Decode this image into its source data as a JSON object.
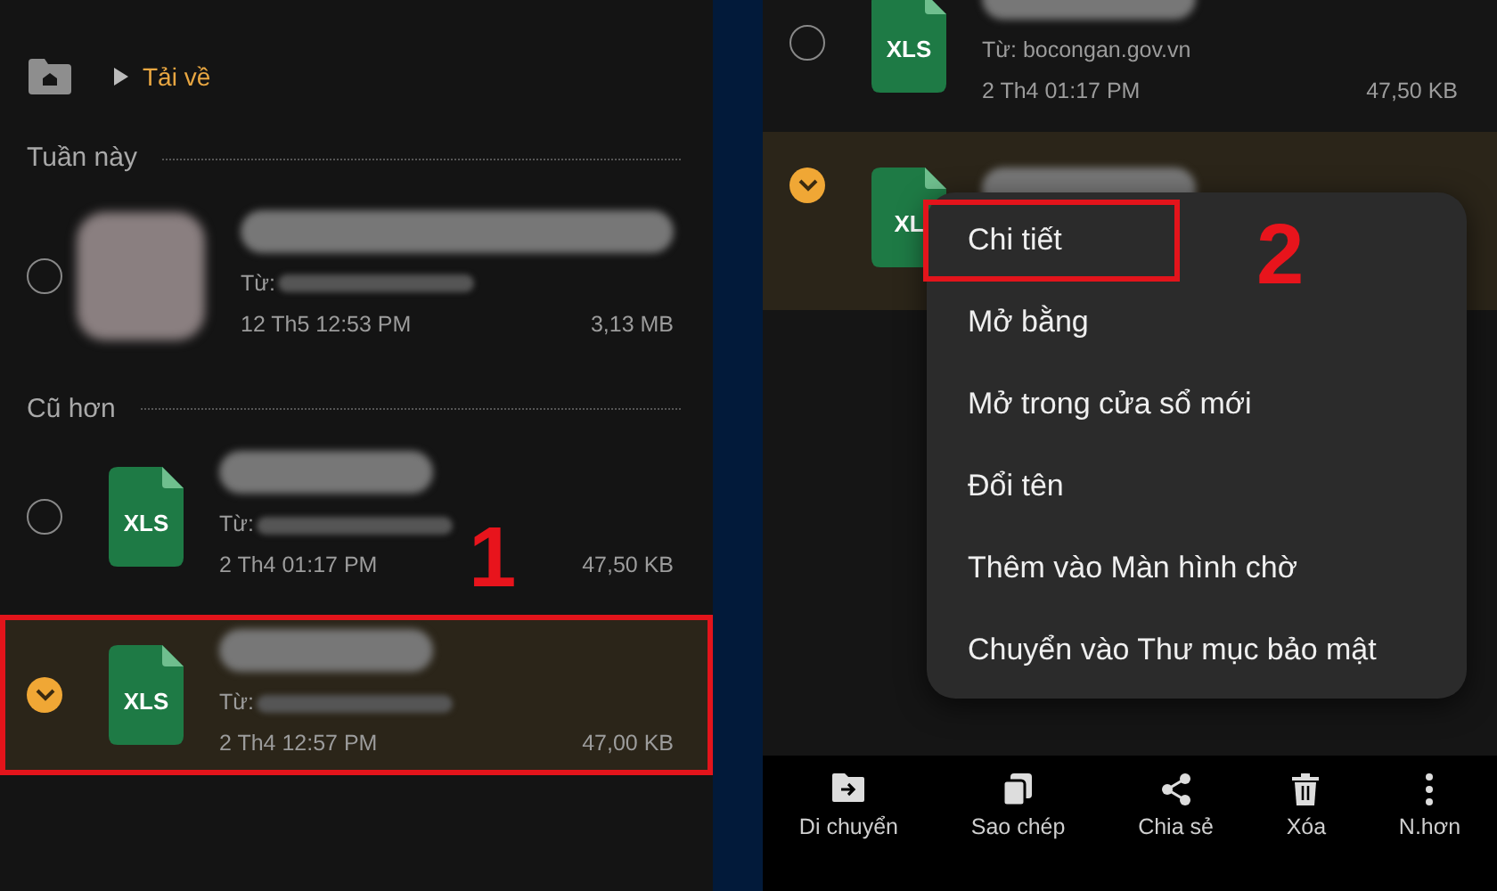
{
  "left_screen": {
    "breadcrumb": {
      "folder": "Tải về"
    },
    "sections": [
      {
        "title": "Tuần này",
        "files": [
          {
            "kind": "image",
            "from": "Từ:",
            "date": "12 Th5 12:53 PM",
            "size": "3,13 MB",
            "selected": false,
            "annotated": false
          }
        ]
      },
      {
        "title": "Cũ hơn",
        "files": [
          {
            "kind": "xls",
            "icon_label": "XLS",
            "from": "Từ:",
            "date": "2 Th4 01:17 PM",
            "size": "47,50 KB",
            "selected": false,
            "annotated": false
          },
          {
            "kind": "xls",
            "icon_label": "XLS",
            "from": "Từ:",
            "date": "2 Th4 12:57 PM",
            "size": "47,00 KB",
            "selected": true,
            "annotated": true
          }
        ]
      }
    ],
    "annotation": "1"
  },
  "right_screen": {
    "files": [
      {
        "kind": "xls",
        "icon_label": "XLS",
        "from": "Từ: bocongan.gov.vn",
        "date": "2 Th4 01:17 PM",
        "size": "47,50 KB",
        "selected": false
      },
      {
        "kind": "xls",
        "icon_label": "XL",
        "selected": true
      }
    ],
    "menu": [
      {
        "label": "Chi tiết",
        "annotated": true
      },
      {
        "label": "Mở bằng",
        "annotated": false
      },
      {
        "label": "Mở trong cửa sổ mới",
        "annotated": false
      },
      {
        "label": "Đổi tên",
        "annotated": false
      },
      {
        "label": "Thêm vào Màn hình chờ",
        "annotated": false
      },
      {
        "label": "Chuyển vào Thư mục bảo mật",
        "annotated": false
      }
    ],
    "annotation": "2",
    "toolbar": [
      {
        "label": "Di chuyển",
        "kind": "move"
      },
      {
        "label": "Sao chép",
        "kind": "copy"
      },
      {
        "label": "Chia sẻ",
        "kind": "share"
      },
      {
        "label": "Xóa",
        "kind": "delete"
      },
      {
        "label": "N.hơn",
        "kind": "more"
      }
    ]
  }
}
